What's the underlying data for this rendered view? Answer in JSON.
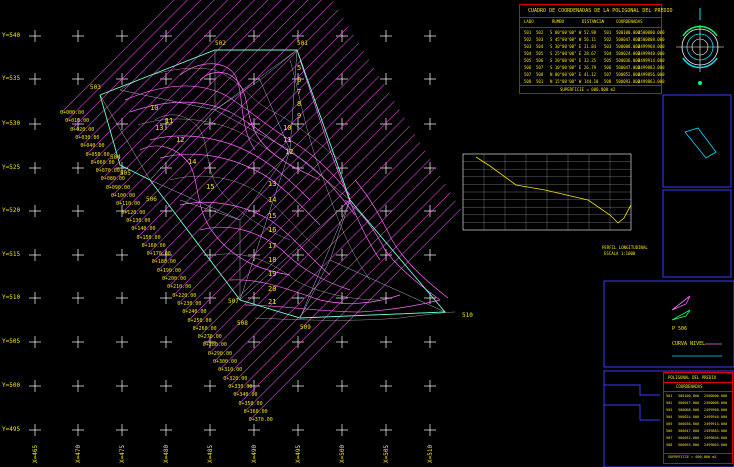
{
  "y_grid_labels": [
    "Y=540",
    "Y=535",
    "Y=530",
    "Y=525",
    "Y=520",
    "Y=515",
    "Y=510",
    "Y=505",
    "Y=500",
    "Y=495"
  ],
  "x_grid_labels": [
    "X=465",
    "X=470",
    "X=475",
    "X=480",
    "X=485",
    "X=490",
    "X=495",
    "X=500",
    "X=505",
    "X=510"
  ],
  "station_labels": [
    "0+000.00",
    "0+010.00",
    "0+020.00",
    "0+030.00",
    "0+040.00",
    "0+050.00",
    "0+060.00",
    "0+070.00",
    "0+080.00",
    "0+090.00",
    "0+100.00",
    "0+110.00",
    "0+120.00",
    "0+130.00",
    "0+140.00",
    "0+150.00",
    "0+160.00",
    "0+170.00",
    "0+180.00",
    "0+190.00",
    "0+200.00",
    "0+210.00",
    "0+220.00",
    "0+230.00",
    "0+240.00",
    "0+250.00",
    "0+260.00",
    "0+270.00",
    "0+280.00",
    "0+290.00",
    "0+300.00",
    "0+310.00",
    "0+320.00",
    "0+330.00",
    "0+340.00",
    "0+350.00",
    "0+360.00",
    "0+370.00"
  ],
  "point_labels": {
    "p502": "502",
    "p501": "501",
    "p503": "503",
    "p504": "504",
    "p505": "505",
    "p506": "506",
    "p507": "507",
    "p508": "508",
    "p509": "509",
    "p510": "510",
    "p511": "511"
  },
  "contour_labels": [
    "5",
    "6",
    "7",
    "8",
    "9",
    "10",
    "11",
    "12",
    "13",
    "14",
    "15",
    "16",
    "17",
    "18",
    "19",
    "20",
    "21",
    "12",
    "14",
    "15",
    "10",
    "11",
    "13"
  ],
  "coords_table": {
    "title": "CUADRO DE COORDENADAS DE LA POLIGONAL DEL PREDIO",
    "headers": [
      "LADO",
      "RUMBO",
      "DISTANCIA",
      "V",
      "COORDENADAS"
    ],
    "rows": [
      [
        "501",
        "502",
        "S 80°00'00\" W",
        "52.98",
        "501",
        "500100.000",
        "2500000.000"
      ],
      [
        "502",
        "503",
        "S 45°00'00\" W",
        "56.11",
        "502",
        "500047.000",
        "2500008.000"
      ],
      [
        "503",
        "504",
        "S 30°00'00\" E",
        "31.84",
        "503",
        "500008.000",
        "2499968.000"
      ],
      [
        "504",
        "505",
        "S 25°00'00\" E",
        "28.67",
        "504",
        "500024.000",
        "2499940.000"
      ],
      [
        "505",
        "506",
        "S 20°00'00\" E",
        "33.25",
        "505",
        "500036.000",
        "2499914.000"
      ],
      [
        "506",
        "507",
        "S 10°00'00\" E",
        "26.79",
        "506",
        "500047.000",
        "2499883.000"
      ],
      [
        "507",
        "508",
        "N 80°00'00\" E",
        "41.12",
        "507",
        "500052.000",
        "2499856.000"
      ],
      [
        "508",
        "501",
        "N 15°00'00\" W",
        "144.10",
        "508",
        "500093.000",
        "2499863.000"
      ]
    ],
    "footer": "SUPERFICIE = 000,000 m2"
  },
  "profile": {
    "title": "PERFIL LONGITUDINAL",
    "subtitle": "ESCALA 1:1000"
  },
  "legend": {
    "point_label": "P  506",
    "curve_label": "CURVA NIVEL"
  },
  "small_table": {
    "title": "POLIGONAL DEL PREDIO",
    "header": "COORDENADAS",
    "rows": [
      [
        "501",
        "500100.000",
        "2500000.000"
      ],
      [
        "502",
        "500047.000",
        "2500008.000"
      ],
      [
        "503",
        "500008.000",
        "2499968.000"
      ],
      [
        "504",
        "500024.000",
        "2499940.000"
      ],
      [
        "505",
        "500036.000",
        "2499914.000"
      ],
      [
        "506",
        "500047.000",
        "2499883.000"
      ],
      [
        "507",
        "500052.000",
        "2499856.000"
      ],
      [
        "508",
        "500093.000",
        "2499863.000"
      ]
    ],
    "footer": "SUPERFICIE = 000,000 m2"
  },
  "colors": {
    "background": "#000000",
    "grid": "#ffffff",
    "label": "#f5e400",
    "contour": "#ff66ff",
    "magenta": "#e040e0",
    "triangulation": "#b0b0d0",
    "boundary": "#66ffcc",
    "table_border": "#e00000",
    "frame": "#3a3aff",
    "cyan": "#00e0ff",
    "green": "#00ff66"
  }
}
